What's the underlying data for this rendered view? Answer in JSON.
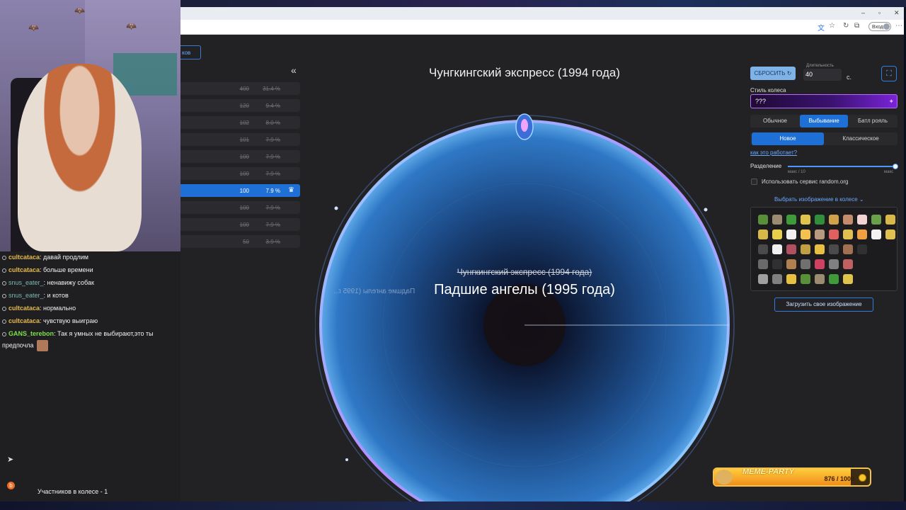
{
  "browser": {
    "toolbar": {
      "signin_label": "Вход"
    }
  },
  "participants": {
    "button_label": "ков",
    "collapse_icon": "«",
    "rows": [
      {
        "count": "400",
        "percent": "31.4 %",
        "eliminated": true
      },
      {
        "count": "120",
        "percent": "9.4 %",
        "eliminated": true
      },
      {
        "count": "102",
        "percent": "8.0 %",
        "eliminated": true
      },
      {
        "count": "101",
        "percent": "7.9 %",
        "eliminated": true
      },
      {
        "count": "100",
        "percent": "7.9 %",
        "eliminated": true
      },
      {
        "count": "100",
        "percent": "7.9 %",
        "eliminated": true
      },
      {
        "count": "100",
        "percent": "7.9 %",
        "eliminated": false,
        "active": true
      },
      {
        "count": "100",
        "percent": "7.9 %",
        "eliminated": true
      },
      {
        "count": "100",
        "percent": "7.9 %",
        "eliminated": true
      },
      {
        "count": "50",
        "percent": "3.9 %",
        "eliminated": true
      }
    ]
  },
  "wheel": {
    "title": "Чунгкингский экспресс (1994 года)",
    "eliminated_name": "Чунгкингский экспресс (1994 года)",
    "winner_name": "Падшие ангелы (1995 года)",
    "mirrored_text": "Падшие ангелы (1995 г..."
  },
  "settings": {
    "reset_label": "СБРОСИТЬ",
    "duration_label": "Длительность",
    "duration_value": "40",
    "duration_unit": "с.",
    "wheel_style_label": "Стиль колеса",
    "wheel_style_value": "???",
    "mode_tabs": [
      "Обычное",
      "Выбывание",
      "Батл рояль"
    ],
    "mode_selected": 1,
    "variant_tabs": [
      "Новое",
      "Классическое"
    ],
    "variant_selected": 0,
    "how_link": "как это работает?",
    "separation_label": "Разделение",
    "separation_min": "макс / 10",
    "separation_max": "макс",
    "separation_level": 1.0,
    "random_org_label": "Использовать сервис random.org",
    "choose_image_label": "Выбрать изображение в колесе",
    "upload_label": "Загрузить свое изображение"
  },
  "chat": {
    "messages": [
      {
        "user": "cultcataca",
        "text": ": давай продлим",
        "style": "cult"
      },
      {
        "user": "cultcataca",
        "text": ": больше времени",
        "style": "cult"
      },
      {
        "user": "snus_eater_",
        "text": ": ненавижу собак",
        "style": "snus"
      },
      {
        "user": "snus_eater_",
        "text": ": и котов",
        "style": "snus"
      },
      {
        "user": "cultcataca",
        "text": ": нормально",
        "style": "cult"
      },
      {
        "user": "cultcataca",
        "text": ": чувствую выиграю",
        "style": "cult"
      },
      {
        "user": "GANS_terebon",
        "text": ": Так я умных не выбирают,это ты",
        "style": "gans"
      }
    ],
    "continuation": "предпочла",
    "footer": "Участников в колесе - 1"
  },
  "meme_party": {
    "title": "MEME-PARTY",
    "count": "876 / 1000",
    "progress": 0.876
  },
  "colors": {
    "accent": "#1e6fd6",
    "wheel_blue": "#2f6fb8",
    "meme_gold": "#f2c14e"
  }
}
